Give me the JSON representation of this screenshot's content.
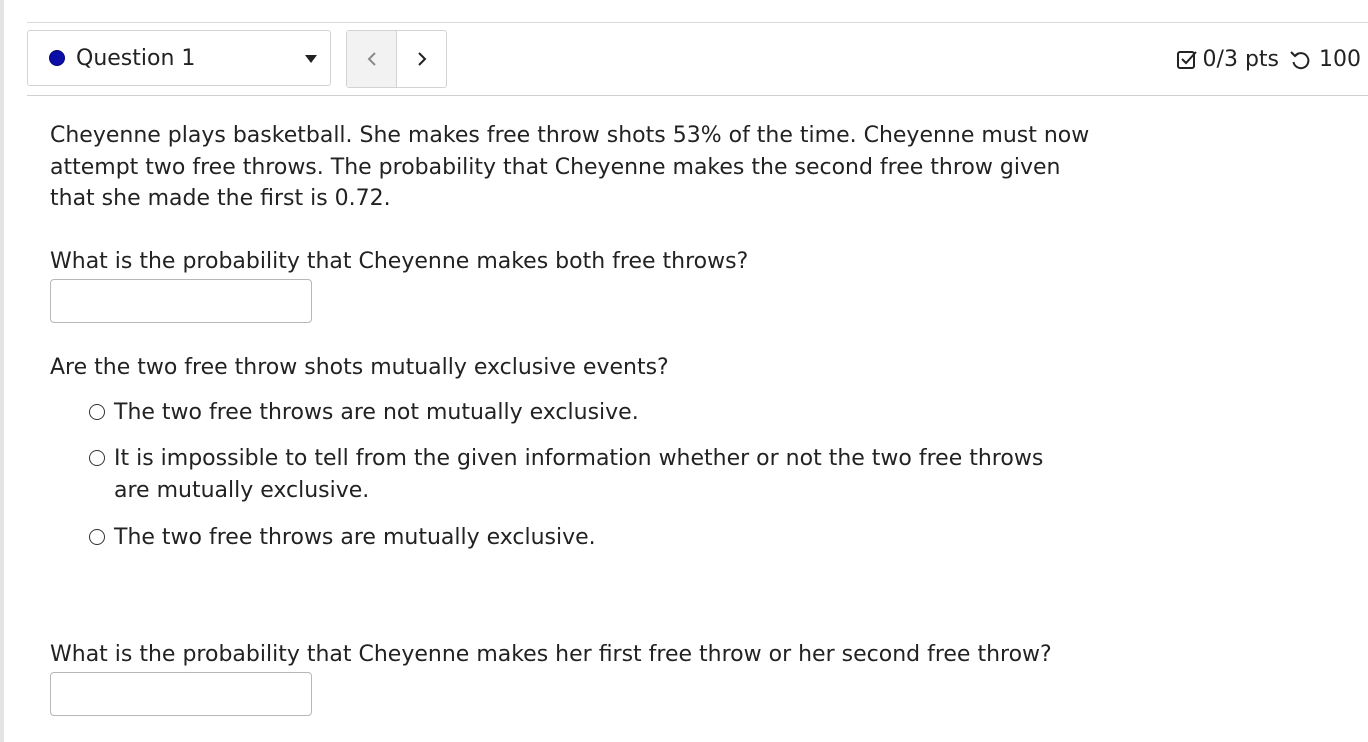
{
  "header": {
    "question_label": "Question 1",
    "prev_symbol": "<",
    "next_symbol": ">",
    "score": "0/3 pts",
    "attempts": "100"
  },
  "question": {
    "prompt": "Cheyenne plays basketball. She makes free throw shots 53% of the time. Cheyenne must now attempt two free throws. The probability that Cheyenne makes the second free throw given that she made the first is 0.72.",
    "part1": {
      "text": "What is the probability that Cheyenne makes both free throws?",
      "value": ""
    },
    "part2": {
      "text": "Are the two free throw shots mutually exclusive events?",
      "options": [
        "The two free throws are not mutually exclusive.",
        "It is impossible to tell from the given information whether or not the two free throws are mutually exclusive.",
        "The two free throws are mutually exclusive."
      ]
    },
    "part3": {
      "text": "What is the probability that Cheyenne makes her first free throw or her second free throw?",
      "value": ""
    }
  },
  "colors": {
    "status_dot": "#0b0fa8",
    "text": "#222222",
    "border": "#d3d3d3"
  },
  "icons": {
    "status": "status-dot-icon",
    "dropdown": "caret-down-icon",
    "score": "checkbox-icon",
    "attempts": "retry-icon"
  }
}
